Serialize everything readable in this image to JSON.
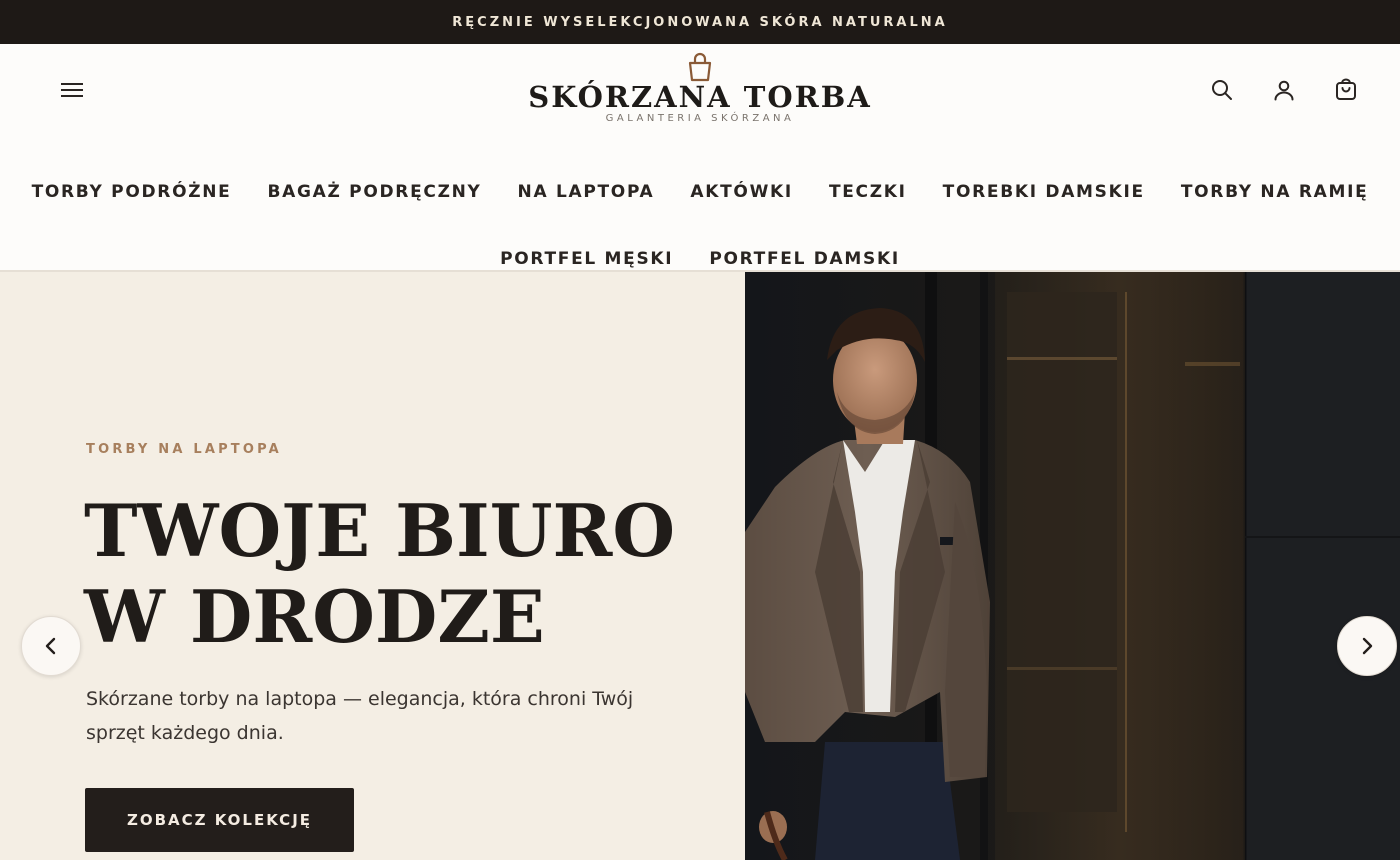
{
  "announcement": "RĘCZNIE WYSELEKCJONOWANA SKÓRA NATURALNA",
  "logo": {
    "name": "SKÓRZANA TORBA",
    "tagline": "GALANTERIA SKÓRZANA"
  },
  "header_icons": [
    "menu-icon",
    "search-icon",
    "user-icon",
    "cart-icon"
  ],
  "nav": {
    "row1": [
      "TORBY PODRÓŻNE",
      "BAGAŻ PODRĘCZNY",
      "NA LAPTOPA",
      "AKTÓWKI",
      "TECZKI",
      "TOREBKI DAMSKIE",
      "TORBY NA RAMIĘ"
    ],
    "row2": [
      "PORTFEL MĘSKI",
      "PORTFEL DAMSKI"
    ]
  },
  "hero": {
    "eyebrow": "TORBY NA LAPTOPA",
    "headline_line1": "TWOJE BIURO",
    "headline_line2": "W DRODZE",
    "description": "Skórzane torby na laptopa — elegancja, która chroni Twój sprzęt każdego dnia.",
    "cta_label": "ZOBACZ KOLEKCJĘ"
  },
  "colors": {
    "topbar": "#1e1916",
    "hero_bg": "#f4eee4",
    "accent": "#a77f5d",
    "button": "#231e1b"
  }
}
